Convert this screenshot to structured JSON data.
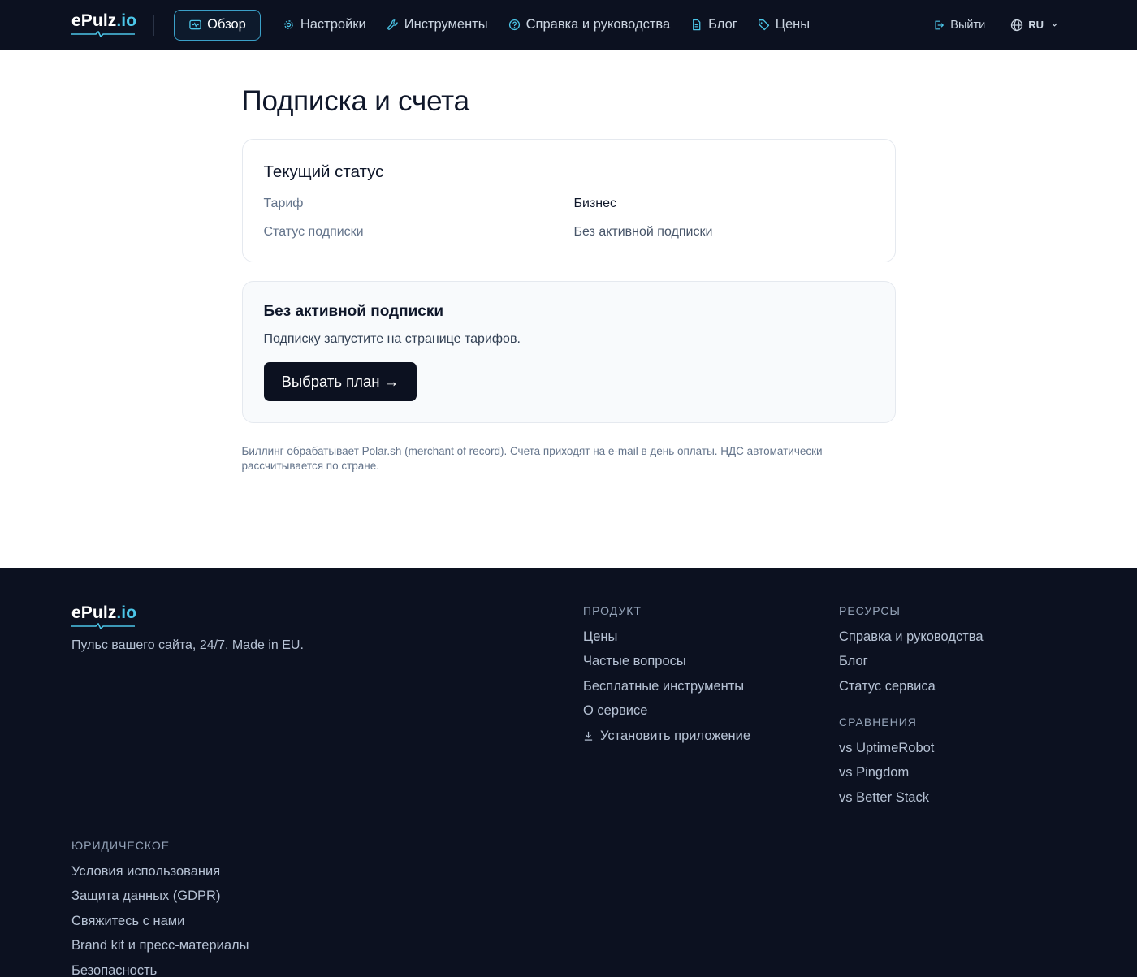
{
  "header": {
    "logo": {
      "main": "ePulz",
      "suffix": ".io"
    },
    "nav": [
      {
        "label": "Обзор",
        "icon": "dashboard-icon",
        "active": true
      },
      {
        "label": "Настройки",
        "icon": "gear-icon"
      },
      {
        "label": "Инструменты",
        "icon": "wrench-icon"
      },
      {
        "label": "Справка и руководства",
        "icon": "help-circle-icon"
      },
      {
        "label": "Блог",
        "icon": "document-icon"
      },
      {
        "label": "Цены",
        "icon": "tag-icon"
      }
    ],
    "logout_label": "Выйти",
    "lang_label": "RU"
  },
  "main": {
    "title": "Подписка и счета",
    "status_card": {
      "title": "Текущий статус",
      "rows": [
        {
          "key": "Тариф",
          "value": "Бизнес"
        },
        {
          "key": "Статус подписки",
          "value": "Без активной подписки"
        }
      ]
    },
    "cta_card": {
      "title": "Без активной подписки",
      "text": "Подписку запустите на странице тарифов.",
      "button": "Выбрать план →"
    },
    "note": "Биллинг обрабатывает Polar.sh (merchant of record). Счета приходят на e-mail в день оплаты. НДС автоматически рассчитывается по стране."
  },
  "footer": {
    "logo": {
      "main": "ePulz",
      "suffix": ".io"
    },
    "tagline": "Пульс вашего сайта, 24/7. Made in EU.",
    "product": {
      "heading": "ПРОДУКТ",
      "links": [
        "Цены",
        "Частые вопросы",
        "Бесплатные инструменты",
        "О сервисе",
        "Установить приложение"
      ]
    },
    "resources": {
      "heading": "РЕСУРСЫ",
      "links": [
        "Справка и руководства",
        "Блог",
        "Статус сервиса"
      ]
    },
    "comparisons": {
      "heading": "СРАВНЕНИЯ",
      "links": [
        "vs UptimeRobot",
        "vs Pingdom",
        "vs Better Stack"
      ]
    },
    "legal": {
      "heading": "ЮРИДИЧЕСКОЕ",
      "links": [
        "Условия использования",
        "Защита данных (GDPR)",
        "Свяжитесь с нами",
        "Brand kit и пресс-материалы",
        "Безопасность"
      ]
    }
  },
  "colors": {
    "nav_bg": "#0c1120",
    "accent": "#4cc6e8",
    "active_border": "#3ba0c8"
  }
}
